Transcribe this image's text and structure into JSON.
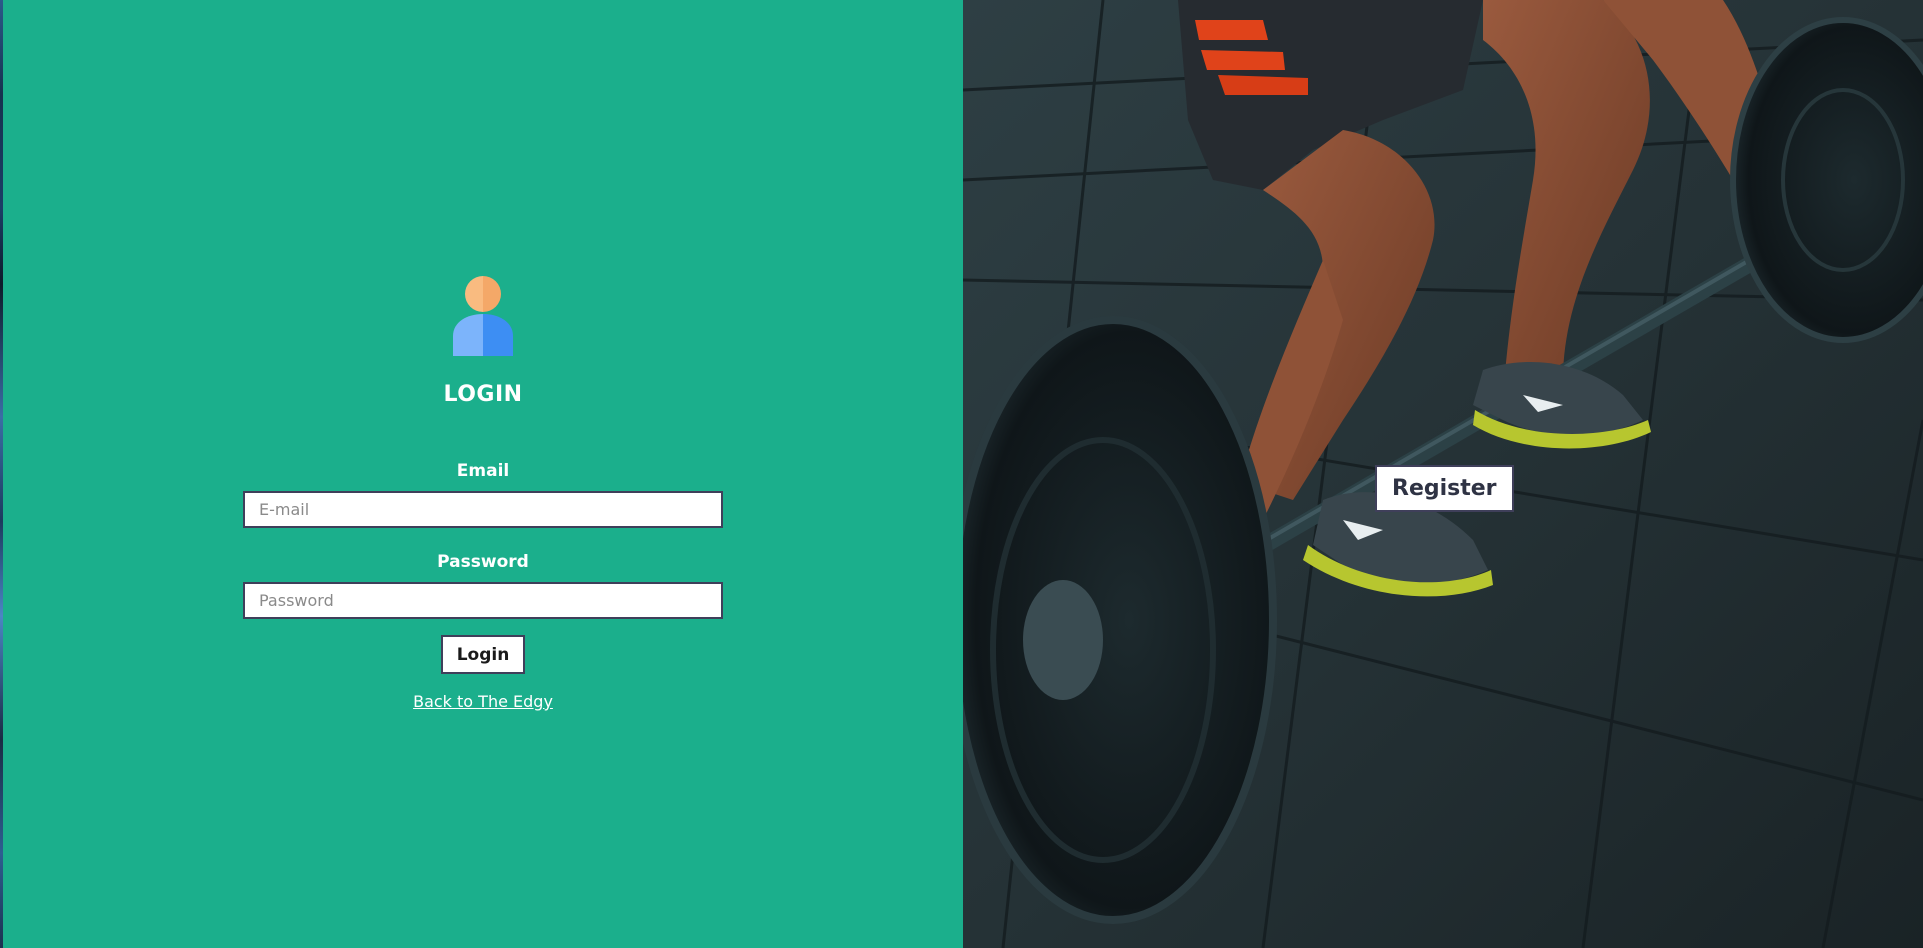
{
  "login": {
    "title": "LOGIN",
    "email_label": "Email",
    "email_placeholder": "E-mail",
    "email_value": "",
    "password_label": "Password",
    "password_placeholder": "Password",
    "password_value": "",
    "submit_label": "Login",
    "back_link": "Back to The Edgy",
    "user_icon": "user-icon"
  },
  "register": {
    "button_label": "Register"
  },
  "photo": {
    "subject": "weightlifter-barbell-photo"
  },
  "colors": {
    "panel_bg": "#1baf8c",
    "border": "#3f3f5a",
    "user_head": "#f9bb80",
    "user_body_light": "#7cb4fb",
    "user_body_dark": "#3d8ef3"
  }
}
